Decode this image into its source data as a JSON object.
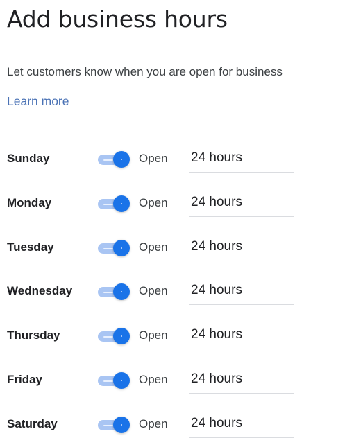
{
  "page": {
    "title": "Add business hours",
    "subtitle": "Let customers know when you are open for business",
    "learn_more": "Learn more"
  },
  "colors": {
    "accent": "#1a73e8",
    "toggle_track": "#a9c5f3",
    "link": "#4a72b5",
    "divider": "#dadce0"
  },
  "days": [
    {
      "day": "Sunday",
      "toggle_on": true,
      "status": "Open",
      "hours": "24 hours"
    },
    {
      "day": "Monday",
      "toggle_on": true,
      "status": "Open",
      "hours": "24 hours"
    },
    {
      "day": "Tuesday",
      "toggle_on": true,
      "status": "Open",
      "hours": "24 hours"
    },
    {
      "day": "Wednesday",
      "toggle_on": true,
      "status": "Open",
      "hours": "24 hours"
    },
    {
      "day": "Thursday",
      "toggle_on": true,
      "status": "Open",
      "hours": "24 hours"
    },
    {
      "day": "Friday",
      "toggle_on": true,
      "status": "Open",
      "hours": "24 hours"
    },
    {
      "day": "Saturday",
      "toggle_on": true,
      "status": "Open",
      "hours": "24 hours"
    }
  ]
}
